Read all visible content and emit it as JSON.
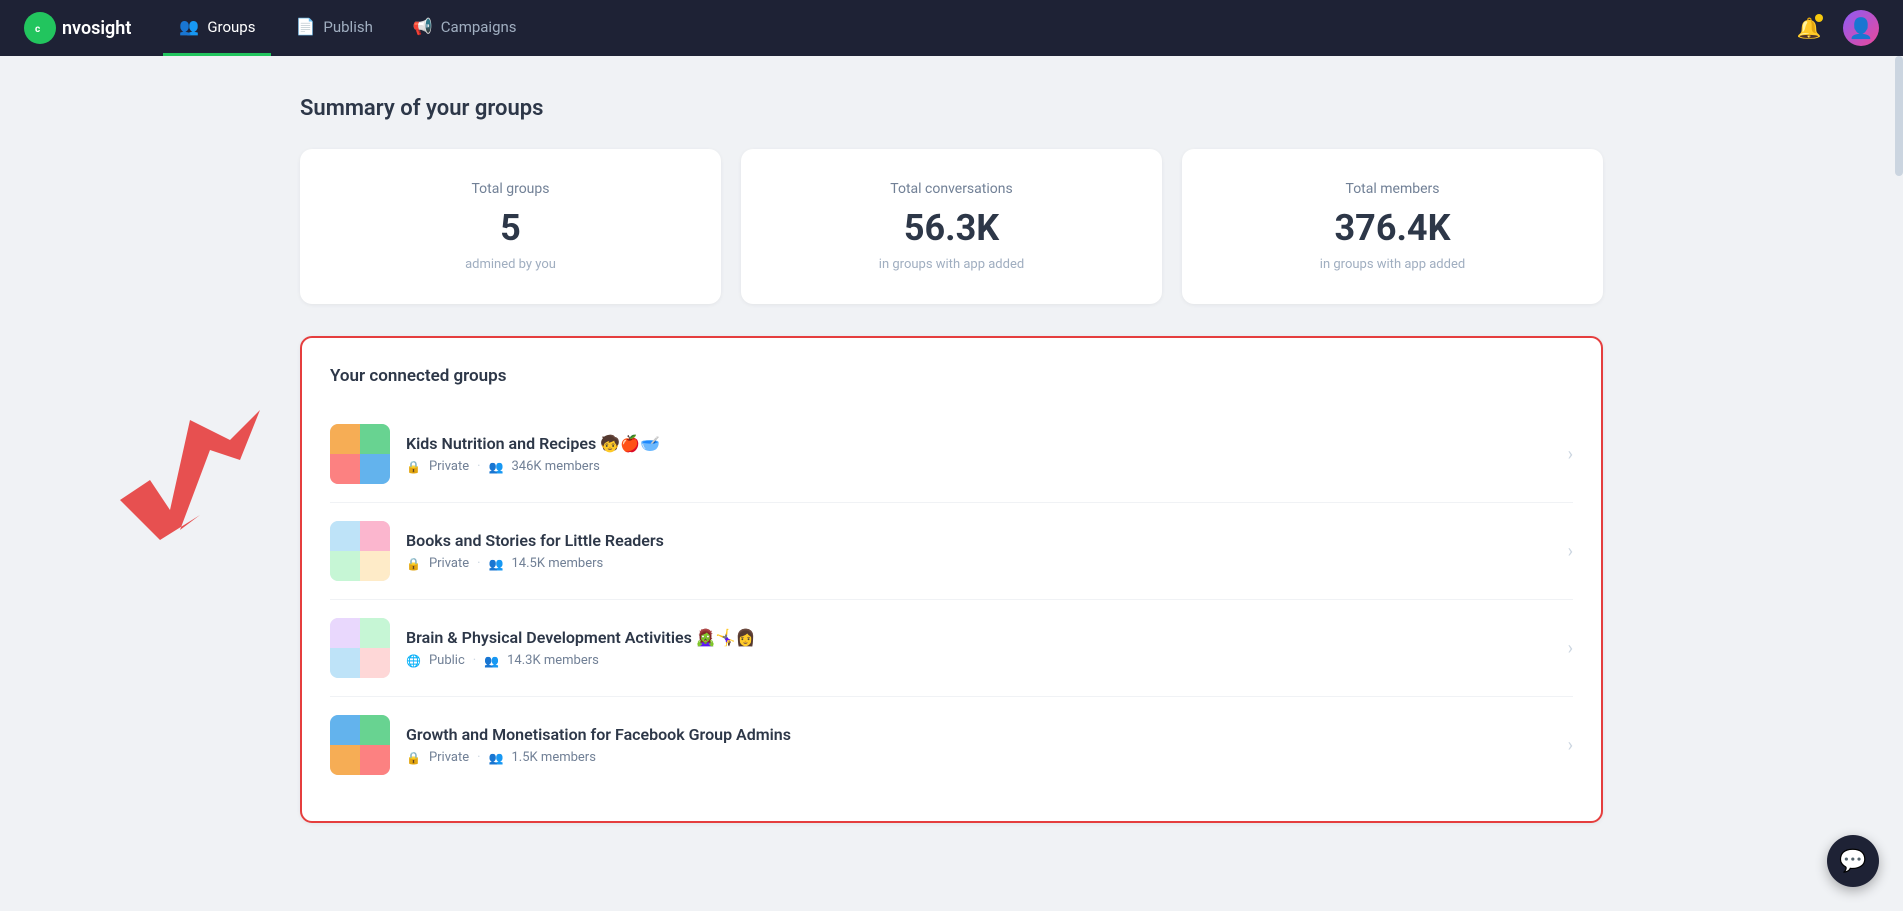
{
  "nav": {
    "logo_text": "nvosight",
    "items": [
      {
        "id": "groups",
        "label": "Groups",
        "icon": "👥",
        "active": true
      },
      {
        "id": "publish",
        "label": "Publish",
        "icon": "📄",
        "active": false
      },
      {
        "id": "campaigns",
        "label": "Campaigns",
        "icon": "📢",
        "active": false
      }
    ]
  },
  "page": {
    "title": "Summary of your groups"
  },
  "stats": [
    {
      "label": "Total groups",
      "value": "5",
      "sub": "admined by you"
    },
    {
      "label": "Total conversations",
      "value": "56.3K",
      "sub": "in groups with app added"
    },
    {
      "label": "Total members",
      "value": "376.4K",
      "sub": "in groups with app added"
    }
  ],
  "connected_groups": {
    "title": "Your connected groups",
    "groups": [
      {
        "id": "kids-nutrition",
        "name": "Kids Nutrition and Recipes 🧒🍎🥣",
        "privacy": "Private",
        "privacy_icon": "🔒",
        "members": "346K members",
        "thumb_class": "thumb-kids"
      },
      {
        "id": "books-stories",
        "name": "Books and Stories for Little Readers",
        "privacy": "Private",
        "privacy_icon": "🔒",
        "members": "14.5K members",
        "thumb_class": "thumb-books"
      },
      {
        "id": "brain-physical",
        "name": "Brain & Physical Development Activities 🧟‍♀️🤸‍♀️👩",
        "privacy": "Public",
        "privacy_icon": "🌐",
        "members": "14.3K members",
        "thumb_class": "thumb-brain"
      },
      {
        "id": "growth-monetisation",
        "name": "Growth and Monetisation for Facebook Group Admins",
        "privacy": "Private",
        "privacy_icon": "🔒",
        "members": "1.5K members",
        "thumb_class": "thumb-growth"
      }
    ]
  },
  "chat_bubble_icon": "💬"
}
